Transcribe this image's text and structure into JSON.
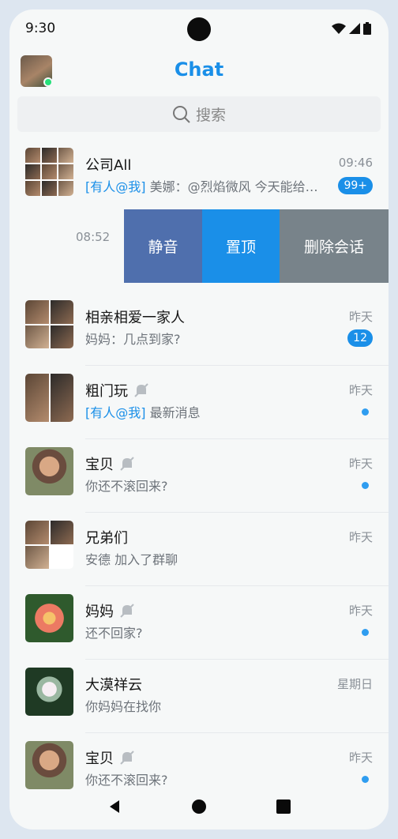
{
  "status_bar": {
    "time": "9:30"
  },
  "header": {
    "title": "Chat"
  },
  "search": {
    "placeholder": "搜索"
  },
  "conversations": [
    {
      "name": "公司All",
      "time": "09:46",
      "mention": "[有人@我]",
      "preview": " 美娜：@烈焰微风 今天能给…",
      "badge": "99+"
    },
    {
      "time": "08:52"
    },
    {
      "name": "相亲相爱一家人",
      "time": "昨天",
      "preview": "妈妈：几点到家?",
      "badge": "12"
    },
    {
      "name": "粗门玩",
      "time": "昨天",
      "mention": "[有人@我]",
      "preview": " 最新消息",
      "muted": true
    },
    {
      "name": "宝贝",
      "time": "昨天",
      "preview": "你还不滚回来?",
      "muted": true
    },
    {
      "name": "兄弟们",
      "time": "昨天",
      "preview": "安德 加入了群聊"
    },
    {
      "name": "妈妈",
      "time": "昨天",
      "preview": "还不回家?",
      "muted": true
    },
    {
      "name": "大漠祥云",
      "time": "星期日",
      "preview": "你妈妈在找你"
    },
    {
      "name": "宝贝",
      "time": "昨天",
      "preview": "你还不滚回来?",
      "muted": true
    }
  ],
  "swipe_actions": {
    "mute": "静音",
    "pin": "置顶",
    "delete": "删除会话"
  },
  "colors": {
    "accent": "#1a8fe8",
    "mute_action": "#4f6fad",
    "delete_action": "#78838a"
  }
}
